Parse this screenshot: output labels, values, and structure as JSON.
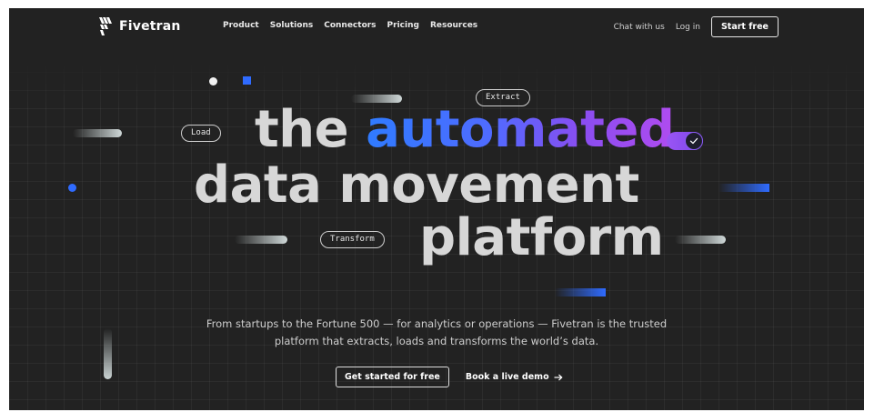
{
  "brand": {
    "name": "Fivetran",
    "logo_icon": "fivetran-logo-icon"
  },
  "nav": {
    "items": [
      {
        "label": "Product"
      },
      {
        "label": "Solutions"
      },
      {
        "label": "Connectors"
      },
      {
        "label": "Pricing"
      },
      {
        "label": "Resources"
      }
    ]
  },
  "header_right": {
    "chat_label": "Chat with us",
    "login_label": "Log in",
    "start_free_label": "Start free"
  },
  "hero": {
    "headline_line1_prefix": "the",
    "headline_line1_highlight": "automated",
    "headline_line2": "data movement",
    "headline_line3": "platform",
    "pills": {
      "extract": "Extract",
      "load": "Load",
      "transform": "Transform"
    },
    "subtext": "From startups to the Fortune 500 — for analytics or operations — Fivetran is the trusted platform that extracts, loads and transforms the world’s data.",
    "cta_primary": "Get started for free",
    "cta_secondary": "Book a live demo",
    "cta_secondary_icon": "arrow-right-icon",
    "toggle_icon": "check-icon"
  },
  "colors": {
    "background": "#222222",
    "accent_blue": "#2f6bff",
    "accent_purple": "#a34cf0",
    "headline_text": "#d7d7d7"
  }
}
